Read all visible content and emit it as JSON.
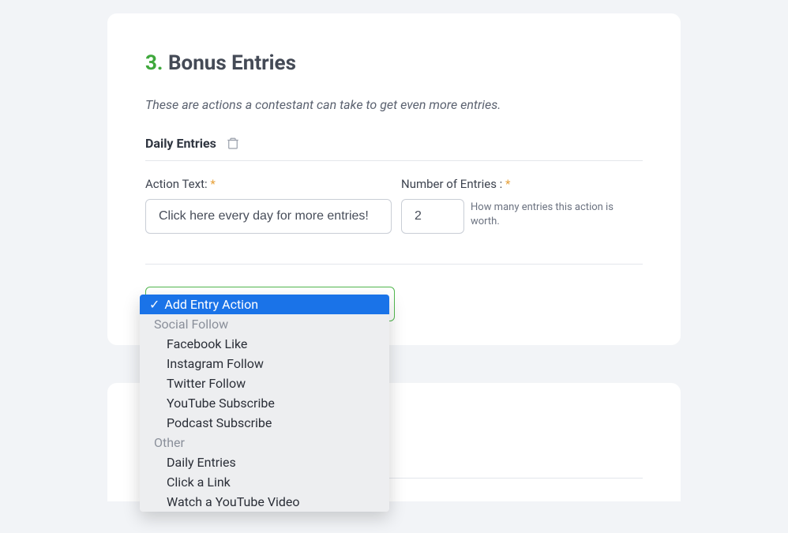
{
  "section": {
    "number": "3.",
    "title": "Bonus Entries",
    "description": "These are actions a contestant can take to get even more entries."
  },
  "entry": {
    "label": "Daily Entries"
  },
  "fields": {
    "actionText": {
      "label": "Action Text:",
      "value": "Click here every day for more entries!"
    },
    "numberEntries": {
      "label": "Number of Entries :",
      "value": "2",
      "helper": "How many entries this action is worth."
    }
  },
  "dropdown": {
    "selected": "Add Entry Action",
    "groups": [
      {
        "label": "Social Follow",
        "items": [
          "Facebook Like",
          "Instagram Follow",
          "Twitter Follow",
          "YouTube Subscribe",
          "Podcast Subscribe"
        ]
      },
      {
        "label": "Other",
        "items": [
          "Daily Entries",
          "Click a Link",
          "Watch a YouTube Video"
        ]
      }
    ]
  }
}
